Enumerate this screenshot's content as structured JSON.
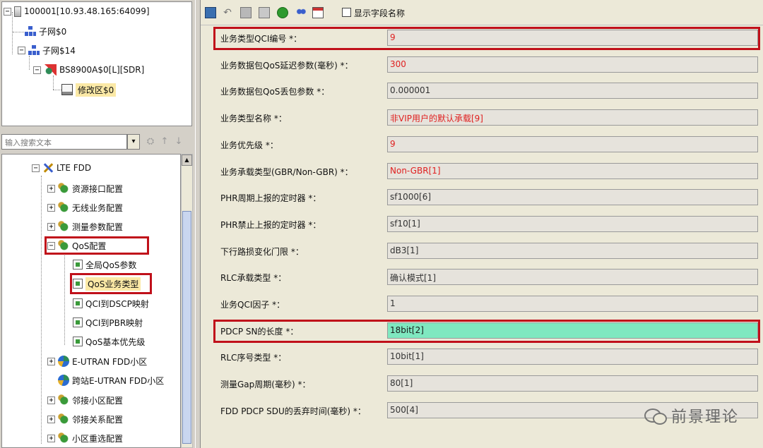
{
  "tree_top": {
    "root_label": "100001[10.93.48.165:64099]",
    "subnet0_label": "子网$0",
    "subnet14_label": "子网$14",
    "bs_label": "BS8900A$0[L][SDR]",
    "edit_area_label": "修改区$0",
    "expander_minus": "−",
    "expander_plus": "+"
  },
  "search": {
    "placeholder": "输入搜索文本",
    "dropdown_glyph": "▾",
    "find_glyph": "⛭",
    "up_glyph": "↑",
    "down_glyph": "↓"
  },
  "tree_config": {
    "lte_fdd": "LTE FDD",
    "resource_interface": "资源接口配置",
    "wireless_service": "无线业务配置",
    "measurement_params": "测量参数配置",
    "qos_config": "QoS配置",
    "global_qos_params": "全局QoS参数",
    "qos_service_type": "QoS业务类型",
    "qci_dscp_mapping": "QCI到DSCP映射",
    "qci_pbr_mapping": "QCI到PBR映射",
    "qos_basic_priority": "QoS基本优先级",
    "eutran_fdd_cell": "E-UTRAN FDD小区",
    "cross_site_eutran_fdd_cell": "跨站E-UTRAN FDD小区",
    "neighbor_cell_config": "邻接小区配置",
    "neighbor_relation_config": "邻接关系配置",
    "cell_reselection_config": "小区重选配置",
    "scroll_up": "▲"
  },
  "toolbar": {
    "undo_glyph": "↶",
    "show_field_name_label": "显示字段名称"
  },
  "form": {
    "rows": [
      {
        "label": "业务类型QCI编号 *：",
        "value": "9"
      },
      {
        "label": "业务数据包QoS延迟参数(毫秒) *：",
        "value": "300"
      },
      {
        "label": "业务数据包QoS丢包参数 *：",
        "value": "0.000001"
      },
      {
        "label": "业务类型名称 *：",
        "value": "非VIP用户的默认承载[9]"
      },
      {
        "label": "业务优先级 *：",
        "value": "9"
      },
      {
        "label": "业务承载类型(GBR/Non-GBR) *：",
        "value": "Non-GBR[1]"
      },
      {
        "label": "PHR周期上报的定时器 *：",
        "value": "sf1000[6]"
      },
      {
        "label": "PHR禁止上报的定时器 *：",
        "value": "sf10[1]"
      },
      {
        "label": "下行路损变化门限 *：",
        "value": "dB3[1]"
      },
      {
        "label": "RLC承载类型 *：",
        "value": "确认模式[1]"
      },
      {
        "label": "业务QCI因子 *：",
        "value": "1"
      },
      {
        "label": "PDCP SN的长度 *：",
        "value": "18bit[2]"
      },
      {
        "label": "RLC序号类型 *：",
        "value": "10bit[1]"
      },
      {
        "label": "测量Gap周期(毫秒) *：",
        "value": "80[1]"
      },
      {
        "label": "FDD PDCP SDU的丢弃时间(毫秒) *：",
        "value": "500[4]"
      }
    ]
  },
  "watermark": "前景理论",
  "colors": {
    "highlight_box": "#c0101a",
    "highlight_field": "#7fe8c0",
    "red_value": "#e02020"
  }
}
